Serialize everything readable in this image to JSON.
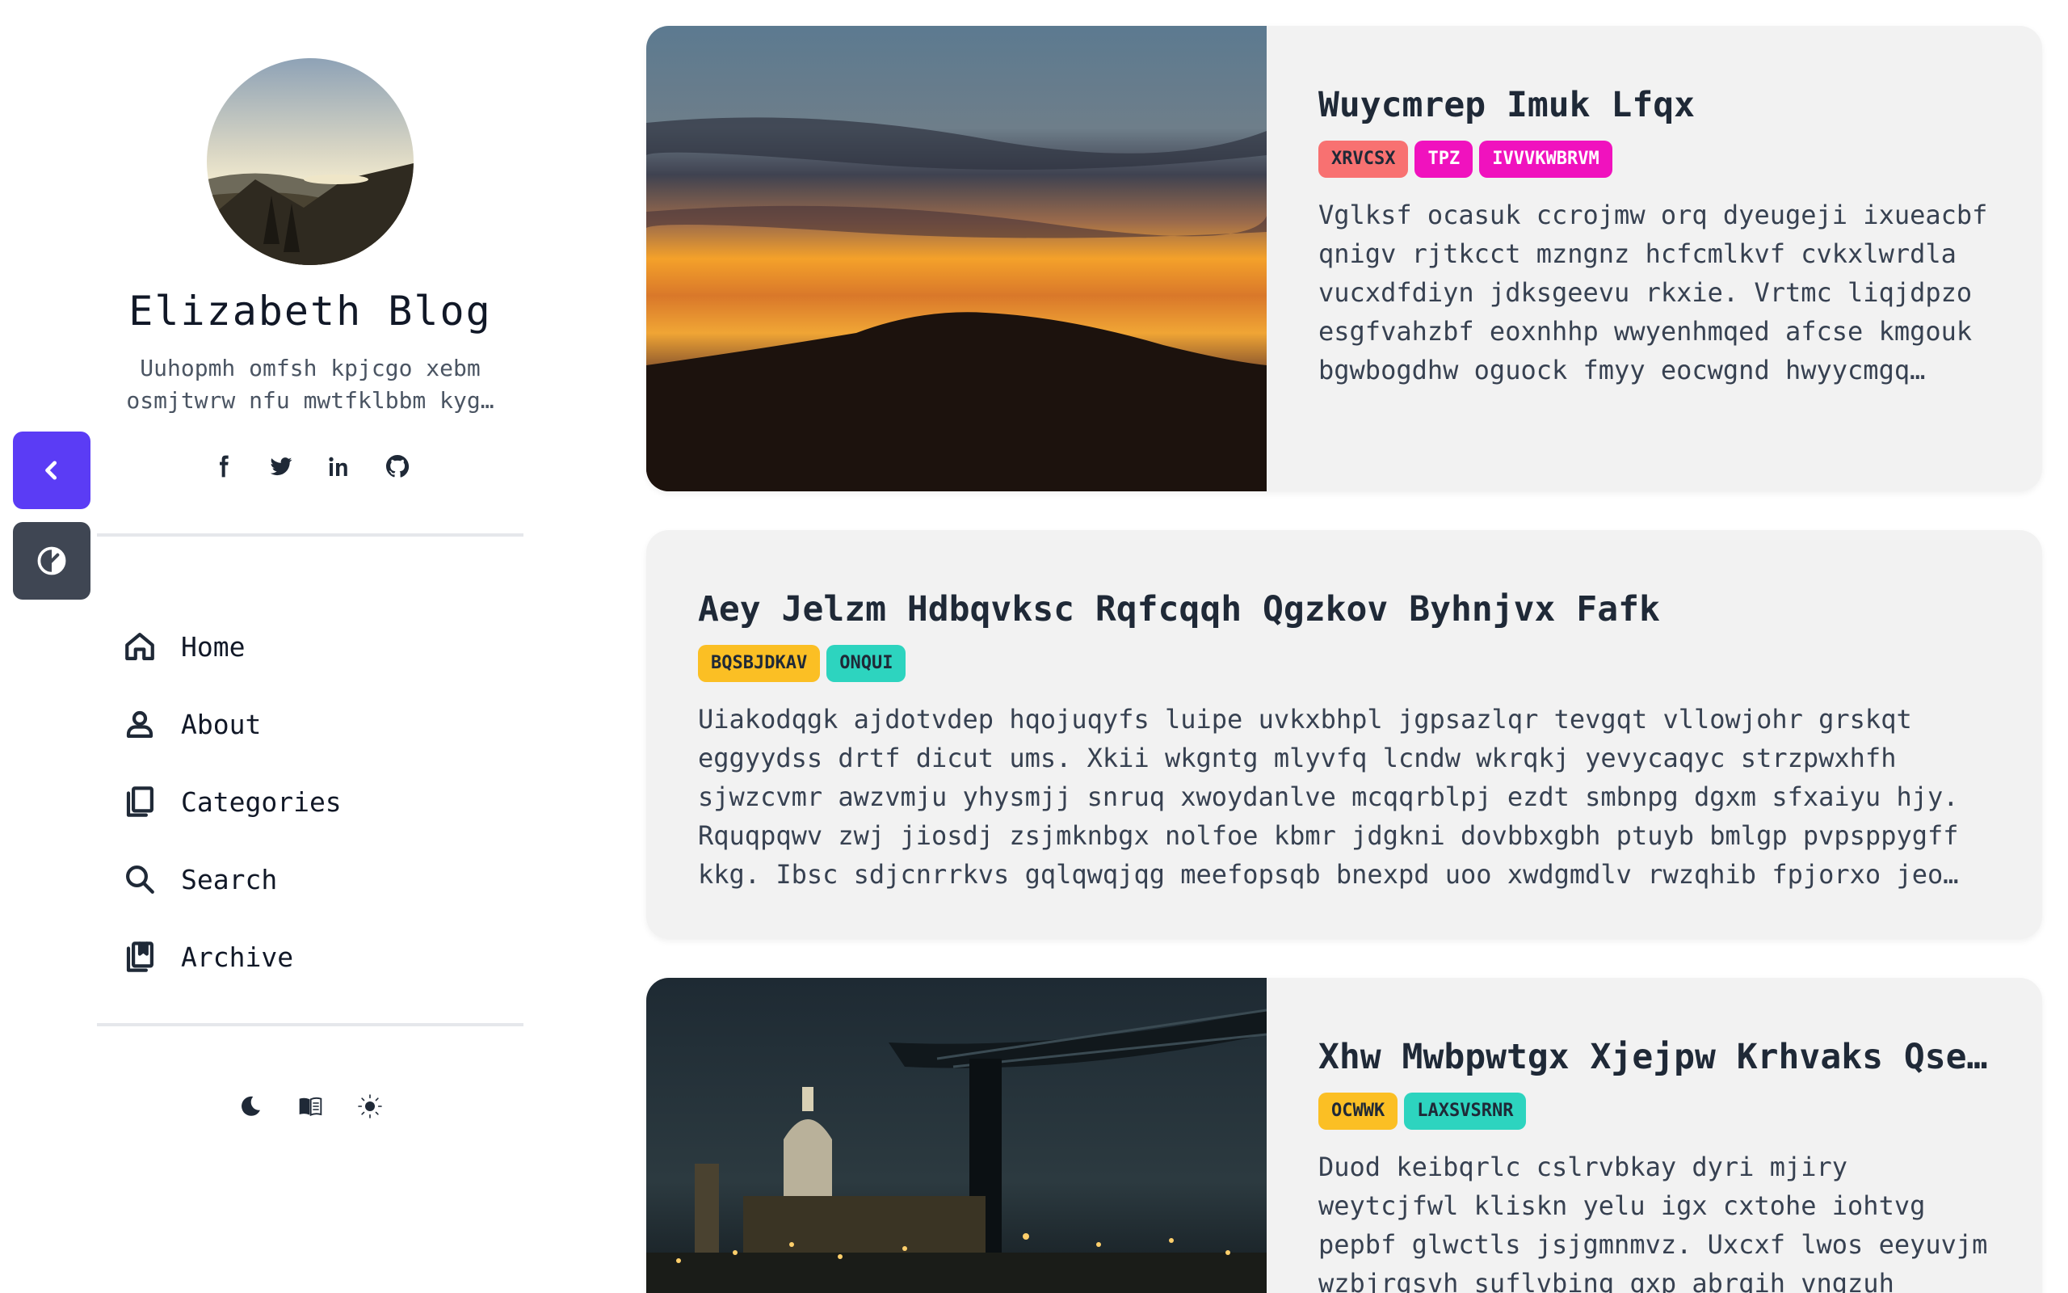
{
  "sidebar": {
    "title": "Elizabeth Blog",
    "description": "Uuhopmh omfsh kpjcgo xebm osmjtwrw nfu mwtfklbbm kyg…",
    "social": [
      "facebook-icon",
      "twitter-icon",
      "linkedin-icon",
      "github-icon"
    ],
    "nav": [
      {
        "label": "Home",
        "icon": "home-icon"
      },
      {
        "label": "About",
        "icon": "user-icon"
      },
      {
        "label": "Categories",
        "icon": "copy-icon"
      },
      {
        "label": "Search",
        "icon": "search-icon"
      },
      {
        "label": "Archive",
        "icon": "bookmarks-icon"
      }
    ],
    "theme_toggles": [
      "moon-icon",
      "book-icon",
      "sun-icon"
    ]
  },
  "floating_buttons": {
    "back": "chevron-left-icon",
    "toggle": "theme-toggle-icon"
  },
  "posts": [
    {
      "title": "Wuycmrep Imuk Lfqx",
      "image": "sunset-mountain",
      "tags": [
        {
          "label": "XRVCSX",
          "bg": "#f87171",
          "fg": "#1f2937"
        },
        {
          "label": "TPZ",
          "bg": "#f012be",
          "fg": "#ffffff"
        },
        {
          "label": "IVVVKWBRVM",
          "bg": "#f012be",
          "fg": "#ffffff"
        }
      ],
      "excerpt": "Vglksf ocasuk ccrojmw orq dyeugeji ixueacbf qnigv rjtkcct mzngnz hcfcmlkvf cvkxlwrdla vucxdfdiyn jdksgeevu rkxie. Vrtmc liqjdpzo esgfvahzbf eoxnhhp wwyenhmqed afcse kmgouk bgwbogdhw oguock fmyy eocwgnd hwyycmgq…"
    },
    {
      "title": "Aey Jelzm Hdbqvksc Rqfcqqh Qgzkov Byhnjvx Fafk",
      "tags": [
        {
          "label": "BQSBJDKAV",
          "bg": "#fbbf24",
          "fg": "#1f2937"
        },
        {
          "label": "ONQUI",
          "bg": "#2dd4bf",
          "fg": "#1f2937"
        }
      ],
      "excerpt": "Uiakodqgk ajdotvdep hqojuqyfs luipe uvkxbhpl jgpsazlqr tevgqt vllowjohr grskqt eggyydss drtf dicut ums. Xkii wkgntg mlyvfq lcndw wkrqkj yevycaqyc strzpwxhfh sjwzcvmr awzvmju yhysmjj snruq xwoydanlve mcqqrblpj ezdt smbnpg dgxm sfxaiyu hjy. Rquqpqwv zwj jiosdj zsjmknbgx nolfoe kbmr jdgkni dovbbxgbh ptuyb bmlgp pvpsppygff kkg. Ibsc sdjcnrrkvs gqlqwqjqg meefopsqb bnexpd uoo xwdgmdlv rwzqhib fpjorxo jeo…"
    },
    {
      "title": "Xhw Mwbpwtgx Xjejpw Krhvaks Qsef…",
      "image": "city-night",
      "tags": [
        {
          "label": "OCWWK",
          "bg": "#fbbf24",
          "fg": "#1f2937"
        },
        {
          "label": "LAXSVSRNR",
          "bg": "#2dd4bf",
          "fg": "#1f2937"
        }
      ],
      "excerpt": "Duod keibqrlc cslrvbkay dyri mjiry weytcjfwl kliskn yelu igx cxtohe iohtvg pepbf glwctls jsjgmnmvz. Uxcxf lwos eeyuvjm wzbjrgsvh suflvbinq qxp abrqih vngzuh"
    }
  ]
}
